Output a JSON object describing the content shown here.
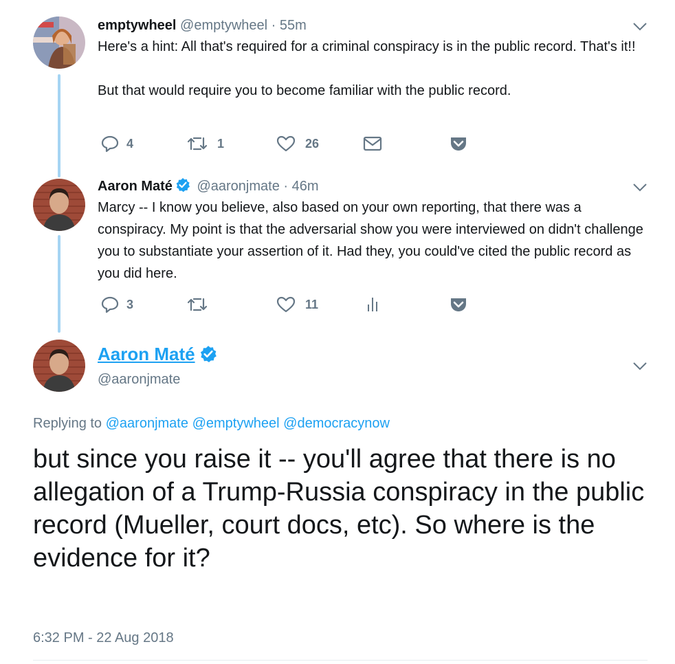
{
  "tweets": [
    {
      "name": "emptywheel",
      "handle": "@emptywheel",
      "separator": "·",
      "time": "55m",
      "paragraphs": [
        "Here's a hint: All that's required for a criminal conspiracy is in the public record. That's it!!",
        "But that would require you to become familiar with the public record."
      ],
      "replies": "4",
      "retweets": "1",
      "likes": "26"
    },
    {
      "name": "Aaron Maté",
      "handle": "@aaronjmate",
      "separator": "·",
      "time": "46m",
      "paragraphs": [
        "Marcy -- I know you believe, also based on your own reporting, that there was a conspiracy. My point is that the adversarial show you were interviewed on didn't challenge you to substantiate your assertion of it. Had they, you could've cited the public record as you did here."
      ],
      "replies": "3",
      "retweets": "",
      "likes": "11"
    }
  ],
  "main": {
    "name": "Aaron Maté",
    "handle": "@aaronjmate",
    "replying_prefix": "Replying to",
    "mentions": [
      "@aaronjmate",
      "@emptywheel",
      "@democracynow"
    ],
    "text": "but since you raise it -- you'll agree that there is no allegation of a Trump-Russia conspiracy in the public record (Mueller, court docs, etc). So where is the evidence for it?",
    "timestamp": "6:32 PM - 22 Aug 2018"
  },
  "colors": {
    "accent": "#1da1f2",
    "thread_line": "#a5d4f3",
    "secondary_text": "#657786",
    "icon": "#657786"
  },
  "icons": [
    "reply-icon",
    "retweet-icon",
    "like-icon",
    "direct-message-icon",
    "analytics-icon",
    "pocket-icon",
    "chevron-down-icon",
    "verified-icon"
  ]
}
